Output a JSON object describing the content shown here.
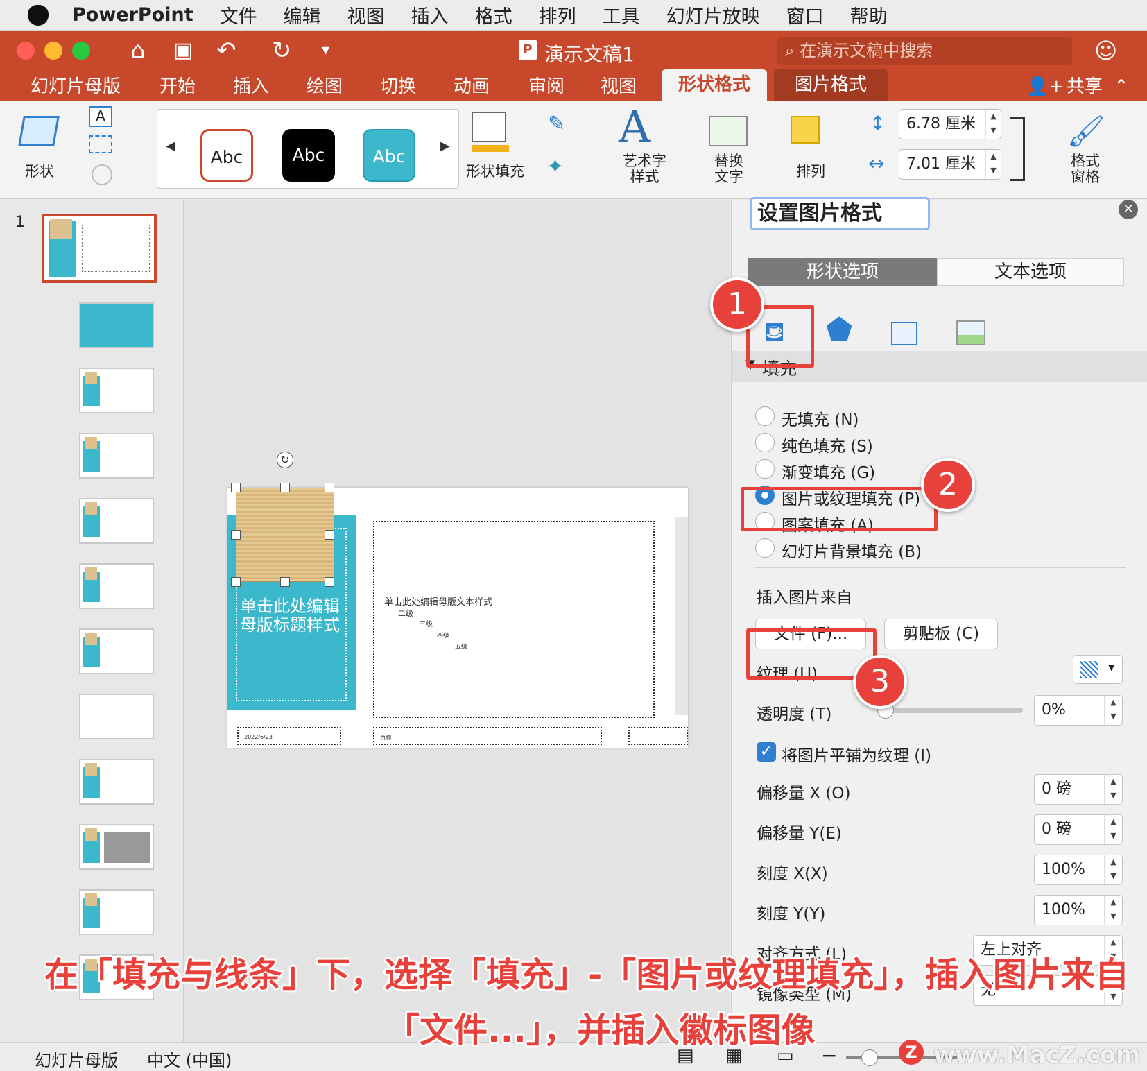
{
  "menubar": {
    "app": "PowerPoint",
    "items": [
      "文件",
      "编辑",
      "视图",
      "插入",
      "格式",
      "排列",
      "工具",
      "幻灯片放映",
      "窗口",
      "帮助"
    ]
  },
  "titlebar": {
    "doc_title": "演示文稿1",
    "doc_badge": "P",
    "search_placeholder": "在演示文稿中搜索"
  },
  "tabs": {
    "items": [
      "幻灯片母版",
      "开始",
      "插入",
      "绘图",
      "切换",
      "动画",
      "审阅",
      "视图"
    ],
    "active": "形状格式",
    "picture": "图片格式",
    "share": "共享"
  },
  "ribbon": {
    "shape": "形状",
    "style_sample": "Abc",
    "shape_fill": "形状填充",
    "art_text": [
      "艺术字",
      "样式"
    ],
    "alt_text": [
      "替换",
      "文字"
    ],
    "arrange": "排列",
    "height": "6.78 厘米",
    "width": "7.01 厘米",
    "format_pane": [
      "格式",
      "窗格"
    ]
  },
  "thumbs": {
    "first_number": "1"
  },
  "slide": {
    "title": "单击此处编辑母版标题样式",
    "body": [
      "单击此处编辑母版文本样式",
      "二级",
      "三级",
      "四级",
      "五级"
    ],
    "footer_date": "2022/6/23",
    "footer": "页脚"
  },
  "pane": {
    "title": "设置图片格式",
    "tabs": [
      "形状选项",
      "文本选项"
    ],
    "section": "填充",
    "options": [
      "无填充 (N)",
      "纯色填充 (S)",
      "渐变填充 (G)",
      "图片或纹理填充 (P)",
      "图案填充 (A)",
      "幻灯片背景填充 (B)"
    ],
    "insert_from": "插入图片来自",
    "file_btn": "文件 (F)...",
    "clipboard_btn": "剪贴板 (C)",
    "texture": "纹理 (U)",
    "transparency": "透明度 (T)",
    "transparency_value": "0%",
    "tile_checkbox": "将图片平铺为纹理 (I)",
    "offset_x": "偏移量 X (O)",
    "offset_x_value": "0 磅",
    "offset_y": "偏移量 Y(E)",
    "offset_y_value": "0 磅",
    "scale_x": "刻度 X(X)",
    "scale_x_value": "100%",
    "scale_y": "刻度 Y(Y)",
    "scale_y_value": "100%",
    "align": "对齐方式 (L)",
    "align_value": "左上对齐",
    "mirror": "镜像类型 (M)",
    "mirror_value": "无"
  },
  "badges": [
    "1",
    "2",
    "3"
  ],
  "caption": {
    "line1": "在「填充与线条」下，选择「填充」-「图片或纹理填充」，插入图片来自",
    "line2": "「文件...」，并插入徽标图像"
  },
  "status": {
    "view": "幻灯片母版",
    "lang": "中文 (中国)",
    "watermark": "www.MacZ.com"
  },
  "colors": {
    "accent": "#c8482b",
    "highlight": "#e8413c",
    "slide_blue": "#3cb8cc"
  }
}
